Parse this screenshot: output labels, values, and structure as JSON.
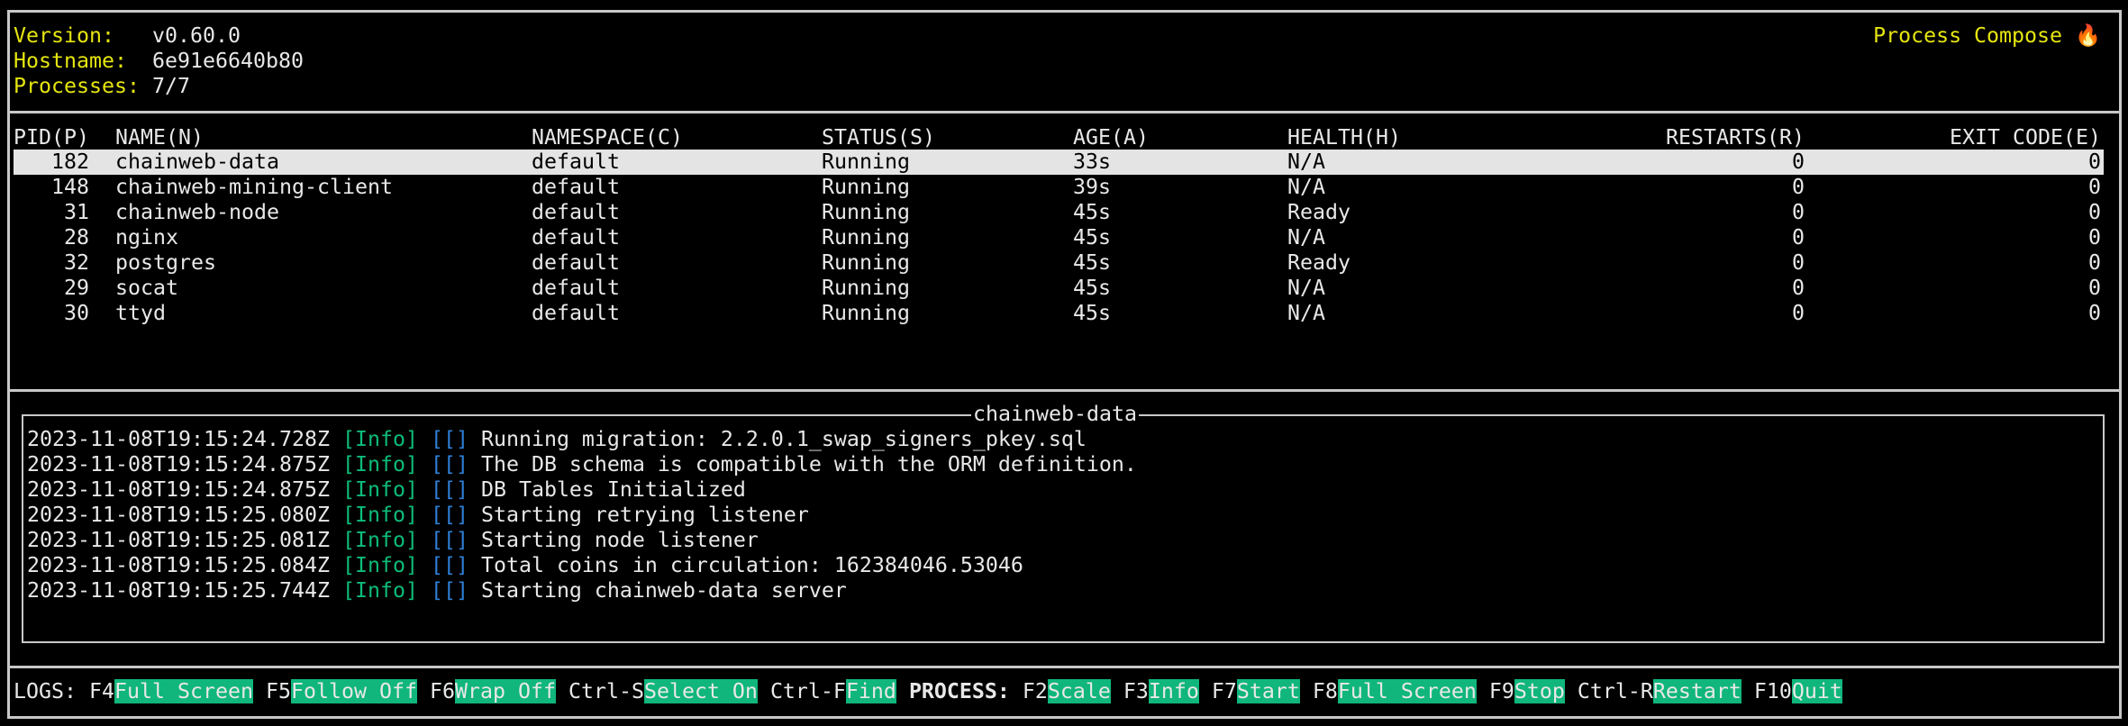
{
  "header": {
    "version_label": "Version:",
    "version": "v0.60.0",
    "hostname_label": "Hostname:",
    "hostname": "6e91e6640b80",
    "processes_label": "Processes:",
    "processes": "7/7",
    "app_title": "Process Compose",
    "app_icon": "fire-icon"
  },
  "table": {
    "columns": [
      "PID(P)",
      "NAME(N)",
      "NAMESPACE(C)",
      "STATUS(S)",
      "AGE(A)",
      "HEALTH(H)",
      "RESTARTS(R)",
      "EXIT CODE(E)"
    ],
    "selected_index": 0,
    "rows": [
      [
        "182",
        "chainweb-data",
        "default",
        "Running",
        "33s",
        "N/A",
        "0",
        "0"
      ],
      [
        "148",
        "chainweb-mining-client",
        "default",
        "Running",
        "39s",
        "N/A",
        "0",
        "0"
      ],
      [
        "31",
        "chainweb-node",
        "default",
        "Running",
        "45s",
        "Ready",
        "0",
        "0"
      ],
      [
        "28",
        "nginx",
        "default",
        "Running",
        "45s",
        "N/A",
        "0",
        "0"
      ],
      [
        "32",
        "postgres",
        "default",
        "Running",
        "45s",
        "Ready",
        "0",
        "0"
      ],
      [
        "29",
        "socat",
        "default",
        "Running",
        "45s",
        "N/A",
        "0",
        "0"
      ],
      [
        "30",
        "ttyd",
        "default",
        "Running",
        "45s",
        "N/A",
        "0",
        "0"
      ]
    ]
  },
  "logs": {
    "title": "chainweb-data",
    "lines": [
      {
        "ts": "2023-11-08T19:15:24.728Z",
        "level": "[Info]",
        "ctx": "[[]",
        "msg": "Running migration: 2.2.0.1_swap_signers_pkey.sql"
      },
      {
        "ts": "2023-11-08T19:15:24.875Z",
        "level": "[Info]",
        "ctx": "[[]",
        "msg": "The DB schema is compatible with the ORM definition."
      },
      {
        "ts": "2023-11-08T19:15:24.875Z",
        "level": "[Info]",
        "ctx": "[[]",
        "msg": "DB Tables Initialized"
      },
      {
        "ts": "2023-11-08T19:15:25.080Z",
        "level": "[Info]",
        "ctx": "[[]",
        "msg": "Starting retrying listener"
      },
      {
        "ts": "2023-11-08T19:15:25.081Z",
        "level": "[Info]",
        "ctx": "[[]",
        "msg": "Starting node listener"
      },
      {
        "ts": "2023-11-08T19:15:25.084Z",
        "level": "[Info]",
        "ctx": "[[]",
        "msg": "Total coins in circulation: 162384046.53046"
      },
      {
        "ts": "2023-11-08T19:15:25.744Z",
        "level": "[Info]",
        "ctx": "[[]",
        "msg": "Starting chainweb-data server"
      }
    ]
  },
  "shortcuts": {
    "logs_label": "LOGS:",
    "process_label": "PROCESS:",
    "logs": [
      {
        "key": "F4",
        "label": "Full Screen"
      },
      {
        "key": "F5",
        "label": "Follow Off"
      },
      {
        "key": "F6",
        "label": "Wrap Off"
      },
      {
        "key": "Ctrl-S",
        "label": "Select On"
      },
      {
        "key": "Ctrl-F",
        "label": "Find"
      }
    ],
    "process": [
      {
        "key": "F2",
        "label": "Scale"
      },
      {
        "key": "F3",
        "label": "Info"
      },
      {
        "key": "F7",
        "label": "Start"
      },
      {
        "key": "F8",
        "label": "Full Screen"
      },
      {
        "key": "F9",
        "label": "Stop"
      },
      {
        "key": "Ctrl-R",
        "label": "Restart"
      },
      {
        "key": "F10",
        "label": "Quit"
      }
    ]
  },
  "colors": {
    "accent": "#10b67c",
    "yellow": "#e5e510",
    "info": "#0dbc79",
    "bracket": "#2f7fd6",
    "selected_bg": "#e4e4e4"
  }
}
